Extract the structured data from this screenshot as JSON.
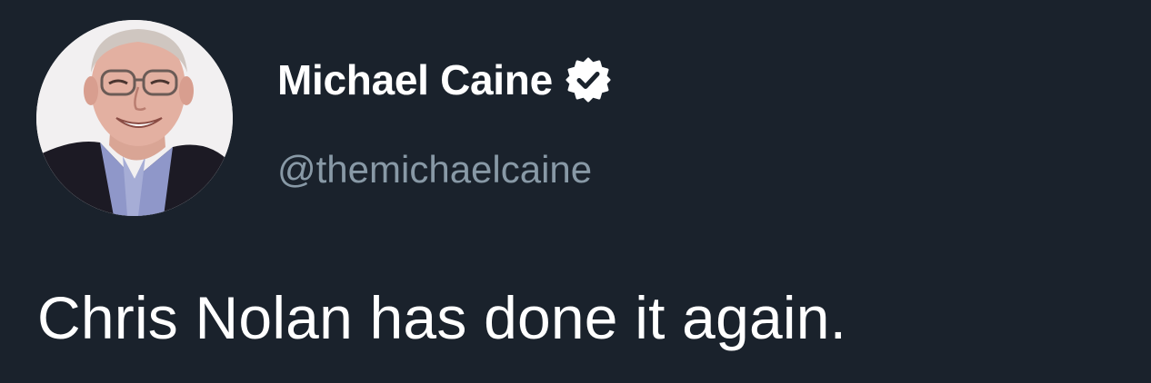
{
  "author": {
    "display_name": "Michael Caine",
    "handle": "@themichaelcaine",
    "verified": true,
    "avatar": "profile-photo"
  },
  "tweet": {
    "text": "Chris Nolan has done it again."
  },
  "colors": {
    "background": "#1a222c",
    "name": "#ffffff",
    "handle": "#8899a6",
    "text": "#ffffff",
    "verified_badge": "#ffffff"
  }
}
